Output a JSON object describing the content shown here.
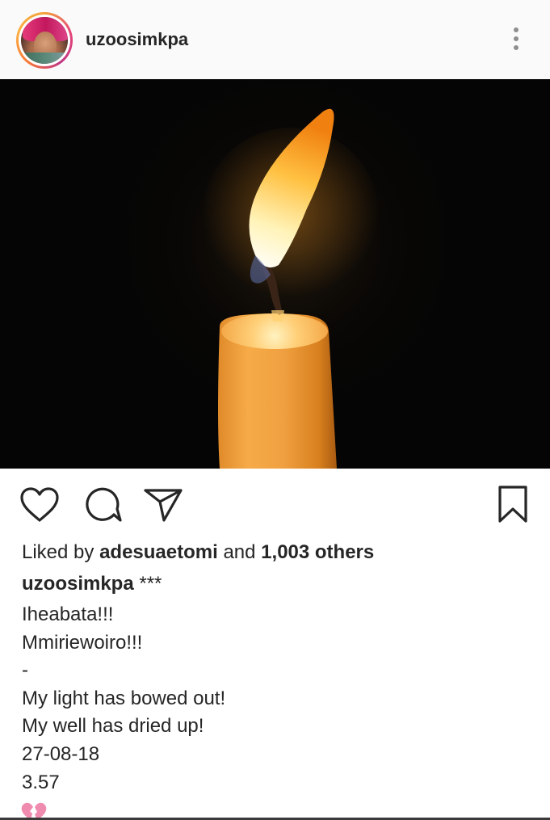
{
  "header": {
    "username": "uzoosimkpa",
    "avatar_icon": "profile-avatar",
    "more_icon": "more-vertical-icon"
  },
  "photo": {
    "subject": "candle-flame"
  },
  "actions": {
    "like_icon": "heart-icon",
    "comment_icon": "comment-bubble-icon",
    "share_icon": "paper-plane-icon",
    "save_icon": "bookmark-icon"
  },
  "likes": {
    "prefix": "Liked by",
    "user": "adesuaetomi",
    "middle": "and",
    "others": "1,003 others"
  },
  "caption": {
    "username": "uzoosimkpa",
    "first_text": "***",
    "lines": [
      "Iheabata!!!",
      "Mmiriewoiro!!!",
      "-",
      "My light has bowed out!",
      "My well has dried up!",
      "27-08-18",
      "3.57"
    ],
    "trailing_emoji": "broken-heart-icon"
  },
  "colors": {
    "text": "#262626",
    "icon": "#262626",
    "muted": "#8e8e8e",
    "header_bg": "#fafafa",
    "emoji_pink": "#f08bb0"
  }
}
